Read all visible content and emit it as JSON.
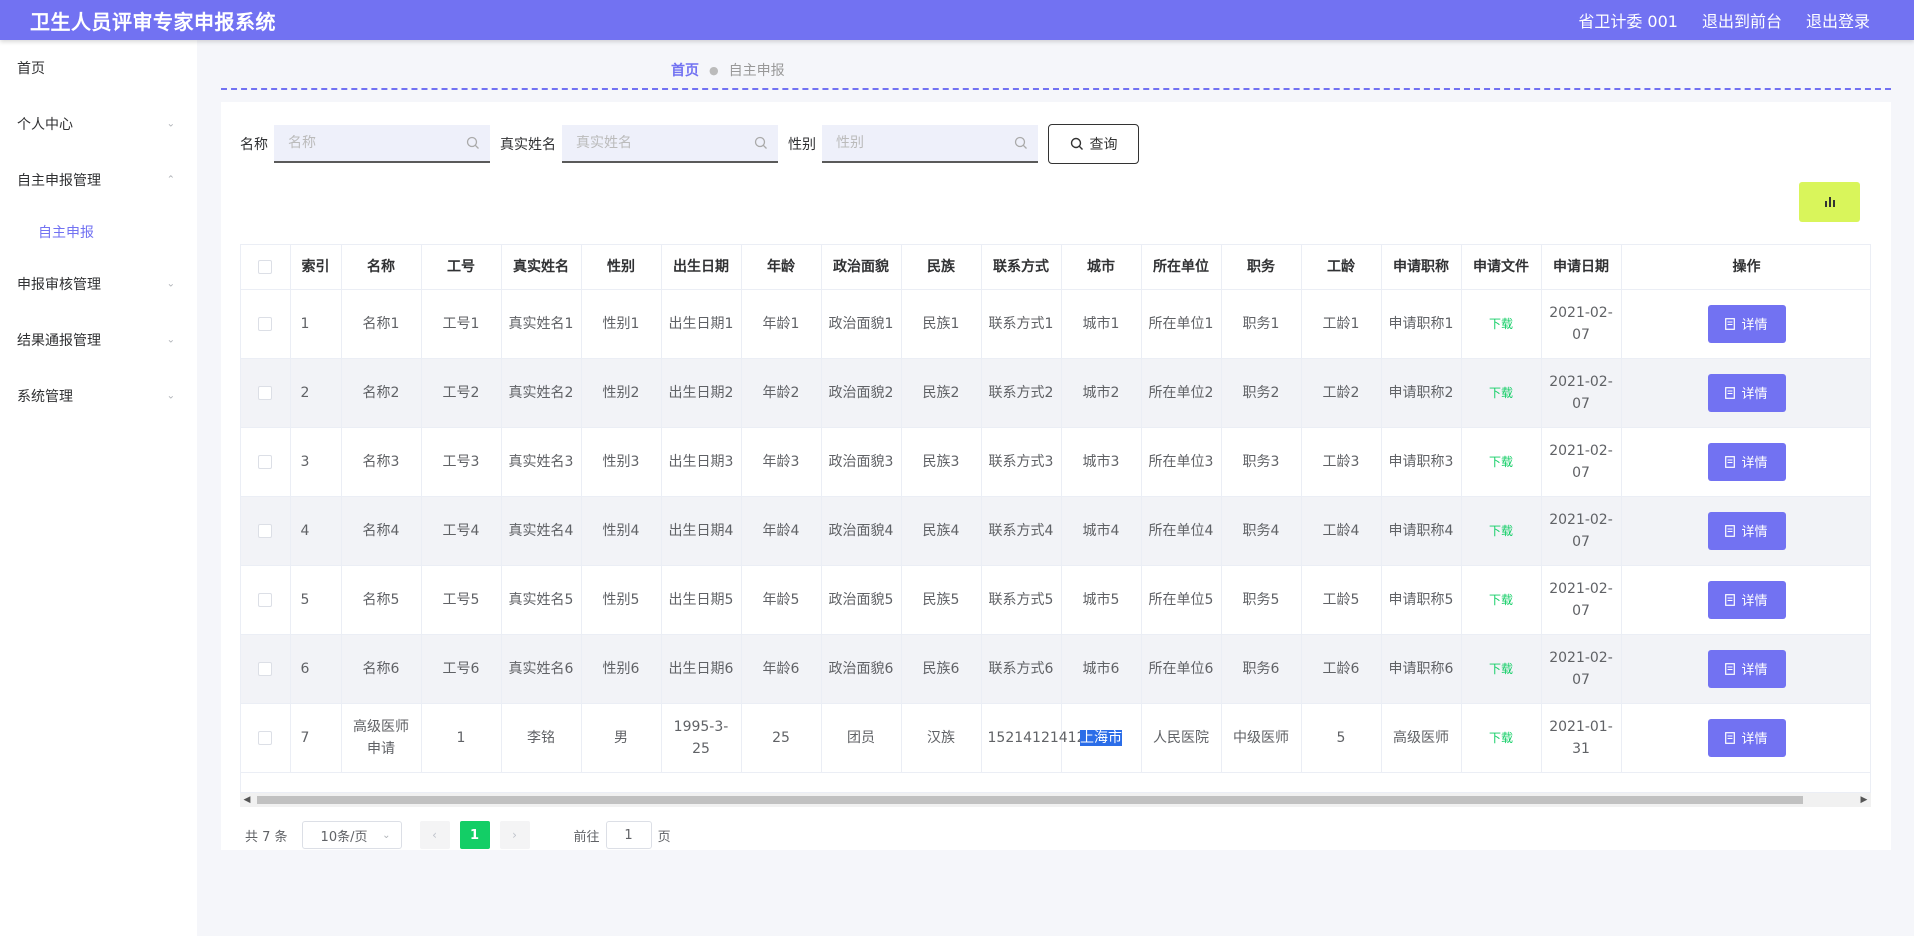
{
  "header": {
    "title": "卫生人员评审专家申报系统",
    "user": "省卫计委 001",
    "back_front": "退出到前台",
    "logout": "退出登录"
  },
  "sidebar": {
    "items": [
      {
        "label": "首页"
      },
      {
        "label": "个人中心"
      },
      {
        "label": "自主申报管理"
      },
      {
        "label": "自主申报"
      },
      {
        "label": "申报审核管理"
      },
      {
        "label": "结果通报管理"
      },
      {
        "label": "系统管理"
      }
    ]
  },
  "breadcrumb": {
    "home": "首页",
    "current": "自主申报"
  },
  "search": {
    "name_label": "名称",
    "name_placeholder": "名称",
    "realname_label": "真实姓名",
    "realname_placeholder": "真实姓名",
    "gender_label": "性别",
    "gender_placeholder": "性别",
    "query_label": "查询"
  },
  "colors": {
    "accent": "#7272f2",
    "download": "#13ce66",
    "chart_button": "#d9f55b"
  },
  "table": {
    "columns": [
      "索引",
      "名称",
      "工号",
      "真实姓名",
      "性别",
      "出生日期",
      "年龄",
      "政治面貌",
      "民族",
      "联系方式",
      "城市",
      "所在单位",
      "职务",
      "工龄",
      "申请职称",
      "申请文件",
      "申请日期",
      "操作"
    ],
    "download_label": "下载",
    "detail_label": "详情",
    "rows": [
      {
        "idx": "1",
        "name": "名称1",
        "no": "工号1",
        "real": "真实姓名1",
        "gender": "性别1",
        "birth": "出生日期1",
        "age": "年龄1",
        "politics": "政治面貌1",
        "nation": "民族1",
        "contact": "联系方式1",
        "city": "城市1",
        "unit": "所在单位1",
        "job": "职务1",
        "years": "工龄1",
        "title": "申请职称1",
        "date": "2021-02-07"
      },
      {
        "idx": "2",
        "name": "名称2",
        "no": "工号2",
        "real": "真实姓名2",
        "gender": "性别2",
        "birth": "出生日期2",
        "age": "年龄2",
        "politics": "政治面貌2",
        "nation": "民族2",
        "contact": "联系方式2",
        "city": "城市2",
        "unit": "所在单位2",
        "job": "职务2",
        "years": "工龄2",
        "title": "申请职称2",
        "date": "2021-02-07"
      },
      {
        "idx": "3",
        "name": "名称3",
        "no": "工号3",
        "real": "真实姓名3",
        "gender": "性别3",
        "birth": "出生日期3",
        "age": "年龄3",
        "politics": "政治面貌3",
        "nation": "民族3",
        "contact": "联系方式3",
        "city": "城市3",
        "unit": "所在单位3",
        "job": "职务3",
        "years": "工龄3",
        "title": "申请职称3",
        "date": "2021-02-07"
      },
      {
        "idx": "4",
        "name": "名称4",
        "no": "工号4",
        "real": "真实姓名4",
        "gender": "性别4",
        "birth": "出生日期4",
        "age": "年龄4",
        "politics": "政治面貌4",
        "nation": "民族4",
        "contact": "联系方式4",
        "city": "城市4",
        "unit": "所在单位4",
        "job": "职务4",
        "years": "工龄4",
        "title": "申请职称4",
        "date": "2021-02-07"
      },
      {
        "idx": "5",
        "name": "名称5",
        "no": "工号5",
        "real": "真实姓名5",
        "gender": "性别5",
        "birth": "出生日期5",
        "age": "年龄5",
        "politics": "政治面貌5",
        "nation": "民族5",
        "contact": "联系方式5",
        "city": "城市5",
        "unit": "所在单位5",
        "job": "职务5",
        "years": "工龄5",
        "title": "申请职称5",
        "date": "2021-02-07"
      },
      {
        "idx": "6",
        "name": "名称6",
        "no": "工号6",
        "real": "真实姓名6",
        "gender": "性别6",
        "birth": "出生日期6",
        "age": "年龄6",
        "politics": "政治面貌6",
        "nation": "民族6",
        "contact": "联系方式6",
        "city": "城市6",
        "unit": "所在单位6",
        "job": "职务6",
        "years": "工龄6",
        "title": "申请职称6",
        "date": "2021-02-07"
      },
      {
        "idx": "7",
        "name": "高级医师申请",
        "no": "1",
        "real": "李铭",
        "gender": "男",
        "birth": "1995-3-25",
        "age": "25",
        "politics": "团员",
        "nation": "汉族",
        "contact": "15214121412",
        "city": "上海市",
        "unit": "人民医院",
        "job": "中级医师",
        "years": "5",
        "title": "高级医师",
        "date": "2021-01-31"
      }
    ]
  },
  "pagination": {
    "total": "共 7 条",
    "page_size": "10条/页",
    "current_page": "1",
    "goto_prefix": "前往",
    "goto_value": "1",
    "goto_suffix": "页"
  }
}
